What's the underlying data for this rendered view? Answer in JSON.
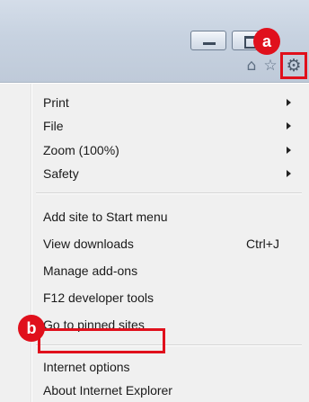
{
  "window_controls": {
    "minimize_icon": "minimize-icon",
    "maximize_icon": "maximize-icon"
  },
  "toolbar": {
    "home_icon": "home-icon",
    "favorites_icon": "star-icon",
    "tools_icon": "gear-icon"
  },
  "callouts": {
    "a": "a",
    "b": "b"
  },
  "highlight_color": "#e0101c",
  "menu": {
    "items": [
      {
        "label": "Print",
        "submenu": true
      },
      {
        "label": "File",
        "submenu": true
      },
      {
        "label": "Zoom (100%)",
        "submenu": true
      },
      {
        "label": "Safety",
        "submenu": true
      },
      {
        "label": "Add site to Start menu"
      },
      {
        "label": "View downloads",
        "shortcut": "Ctrl+J"
      },
      {
        "label": "Manage add-ons"
      },
      {
        "label": "F12 developer tools"
      },
      {
        "label": "Go to pinned sites"
      },
      {
        "label": "Internet options"
      },
      {
        "label": "About Internet Explorer"
      }
    ]
  }
}
